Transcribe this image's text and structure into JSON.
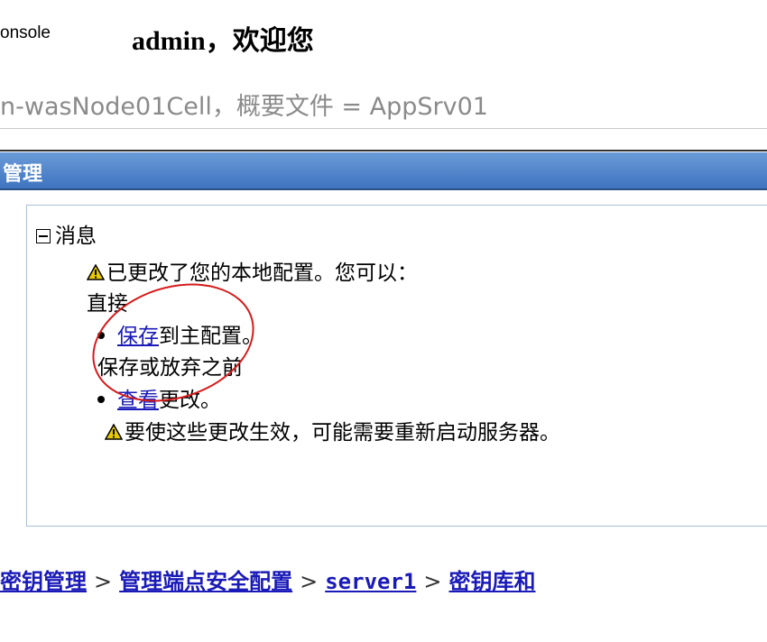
{
  "header": {
    "console_text": "onsole",
    "welcome": "admin，欢迎您"
  },
  "cell_line": "n-wasNode01Cell，概要文件 = AppSrv01",
  "section_title": "管理",
  "messages": {
    "heading": "消息",
    "warning1": "已更改了您的本地配置。您可以：",
    "direct": "直接",
    "save_link": "保存",
    "save_rest": "到主配置。",
    "before": "保存或放弃之前",
    "view_link": "查看",
    "view_rest": "更改。",
    "warning2": "要使这些更改生效，可能需要重新启动服务器。"
  },
  "breadcrumb": {
    "items": [
      "密钥管理",
      "管理端点安全配置",
      "server1",
      "密钥库和"
    ],
    "separator": ">"
  },
  "colors": {
    "titlebar": "#3f74bf",
    "link": "#1a1ab8",
    "annotation_circle": "#d61a1a",
    "warning": "#e8c800"
  }
}
